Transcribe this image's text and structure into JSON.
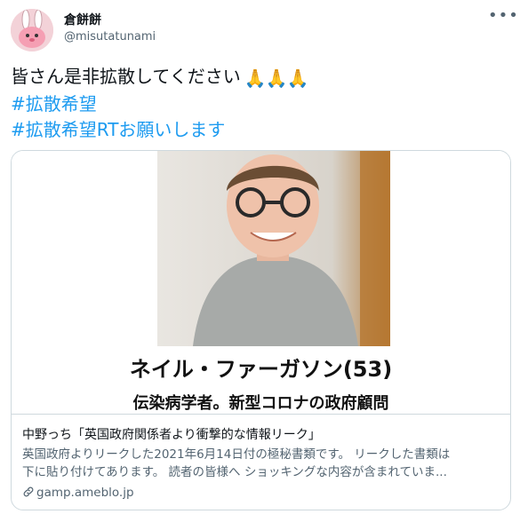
{
  "user": {
    "display_name": "倉餅餅",
    "handle": "@misutatunami",
    "avatar_icon": "bunny-avatar-icon"
  },
  "menu": {
    "more_icon": "more-icon",
    "more_label": "•••"
  },
  "tweet": {
    "line1": "皆さん是非拡散してください",
    "emoji": [
      "🙏",
      "🙏",
      "🙏"
    ],
    "hashtag1": "#拡散希望",
    "hashtag2": "#拡散希望RTお願いします"
  },
  "card": {
    "image_caption_name": "ネイル・ファーガソン(53)",
    "image_caption_role": "伝染病学者。新型コロナの政府顧問",
    "title": "中野っち「英国政府関係者より衝撃的な情報リーク」",
    "description_line1": "英国政府よりリークした2021年6月14日付の極秘書類です。 リークした書類は",
    "description_line2": "下に貼り付けてあります。 読者の皆様へ ショッキングな内容が含まれていま...",
    "domain": "gamp.ameblo.jp"
  },
  "colors": {
    "accent": "#1d9bf0",
    "border": "#cfd9de",
    "muted": "#536471"
  }
}
